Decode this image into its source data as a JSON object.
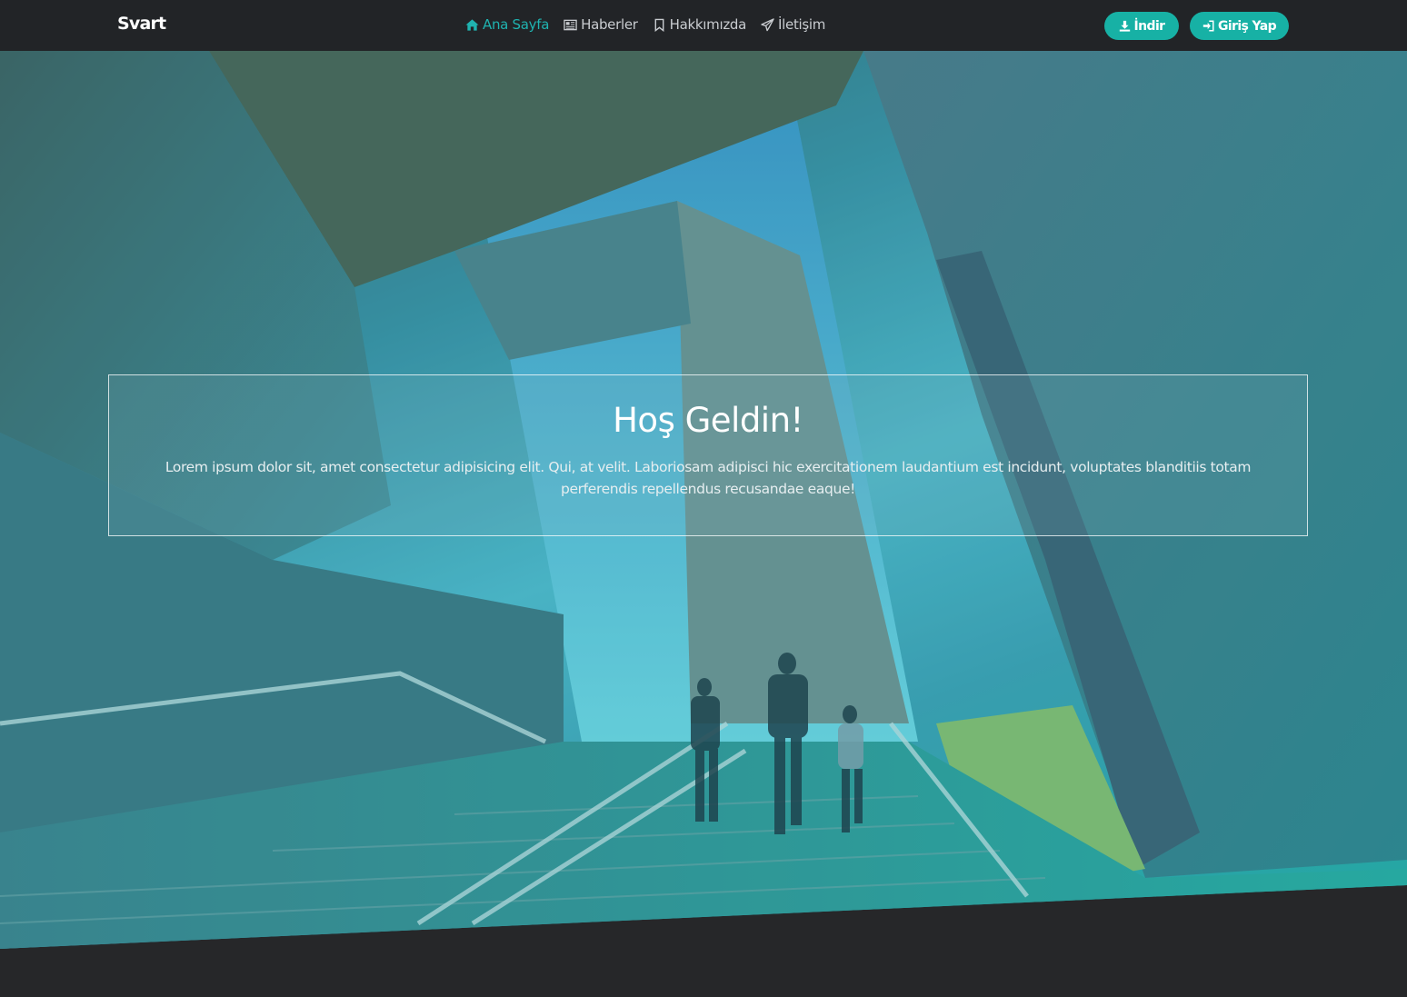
{
  "app": {
    "brand": "Svart"
  },
  "nav": {
    "items": [
      {
        "label": "Ana Sayfa",
        "icon": "home-icon",
        "active": true
      },
      {
        "label": "Haberler",
        "icon": "newspaper-icon",
        "active": false
      },
      {
        "label": "Hakkımızda",
        "icon": "bookmark-icon",
        "active": false
      },
      {
        "label": "İletişim",
        "icon": "paper-plane-icon",
        "active": false
      }
    ]
  },
  "actions": {
    "download_label": "İndir",
    "login_label": "Giriş Yap"
  },
  "hero": {
    "title": "Hoş Geldin!",
    "text": "Lorem ipsum dolor sit, amet consectetur adipisicing elit. Qui, at velit. Laboriosam adipisci hic exercitationem laudantium est incidunt, voluptates blanditiis totam perferendis repellendus recusandae eaque!"
  },
  "colors": {
    "accent": "#1fb3b0",
    "button": "#17b1a5",
    "navbar": "#222427",
    "page": "#262729"
  }
}
